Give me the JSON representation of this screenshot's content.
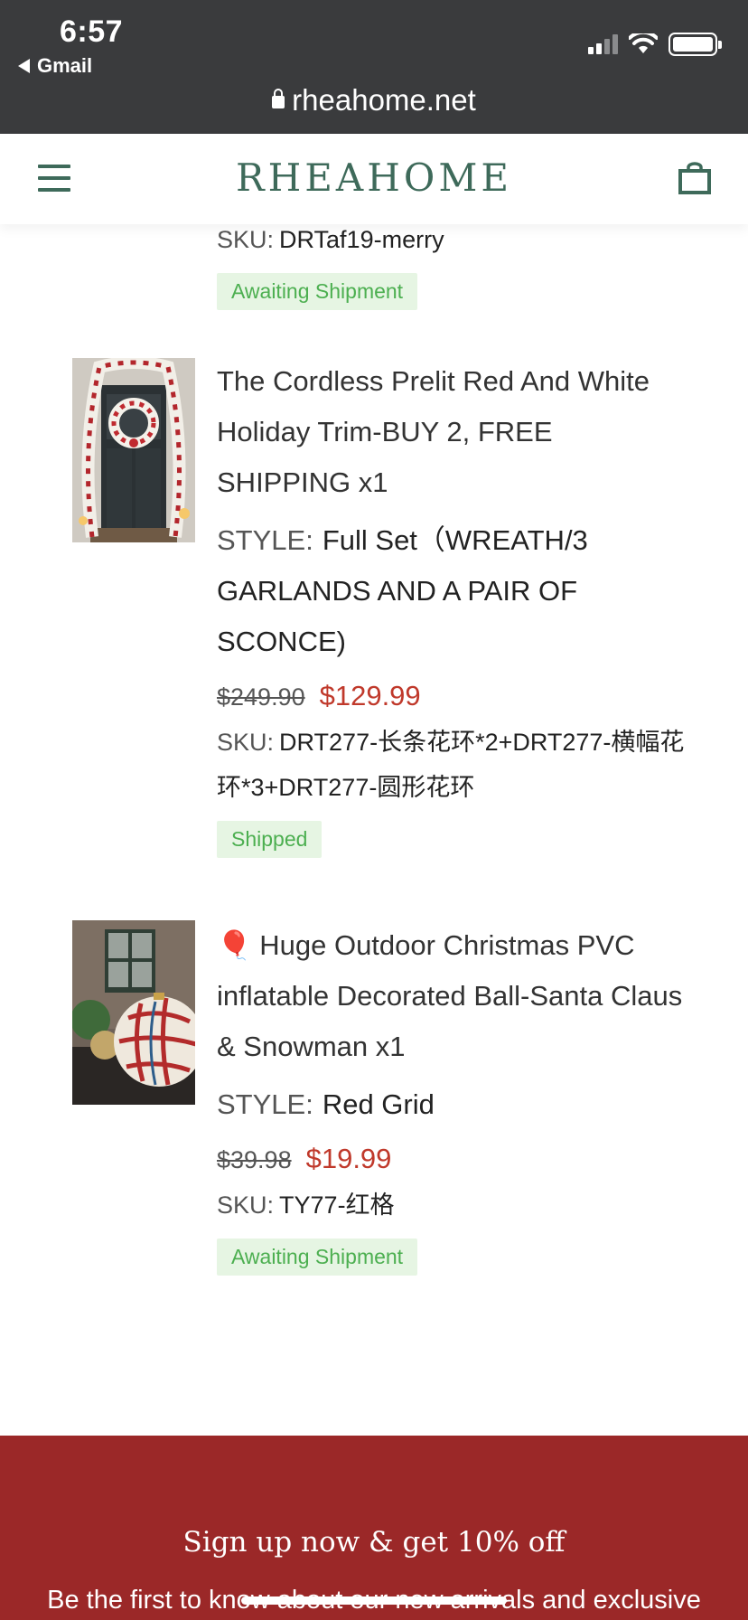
{
  "status_bar": {
    "time": "6:57",
    "back_label": "Gmail",
    "url": "rheahome.net"
  },
  "header": {
    "logo": "RHEAHOME",
    "menu_icon": "hamburger-menu-icon",
    "cart_icon": "shopping-bag-icon"
  },
  "colors": {
    "brand": "#3e6a5a",
    "sale_price": "#c0392b",
    "badge_bg": "#e6f5e3",
    "badge_text": "#4caf50",
    "footer_bg": "#9b2828"
  },
  "prev_item": {
    "sku_label": "SKU:",
    "sku_value": "DRTaf19-merry",
    "status": "Awaiting Shipment"
  },
  "items": [
    {
      "title": "The Cordless Prelit Red And White Holiday Trim-BUY 2, FREE SHIPPING x1",
      "style_label": "STYLE:",
      "style_value": "Full Set（WREATH/3 GARLANDS AND A PAIR OF SCONCE)",
      "old_price": "$249.90",
      "new_price": "$129.99",
      "sku_label": "SKU:",
      "sku_value": "DRT277-长条花环*2+DRT277-横幅花环*3+DRT277-圆形花环",
      "status": "Shipped"
    },
    {
      "title_emoji": "🎈",
      "title": "Huge Outdoor Christmas PVC inflatable Decorated Ball-Santa Claus & Snowman x1",
      "style_label": "STYLE:",
      "style_value": "Red Grid",
      "old_price": "$39.98",
      "new_price": "$19.99",
      "sku_label": "SKU:",
      "sku_value": "TY77-红格",
      "status": "Awaiting Shipment"
    }
  ],
  "footer": {
    "title": "Sign up now & get 10% off",
    "subtitle": "Be the first to know about our new arrivals and exclusive offers"
  }
}
